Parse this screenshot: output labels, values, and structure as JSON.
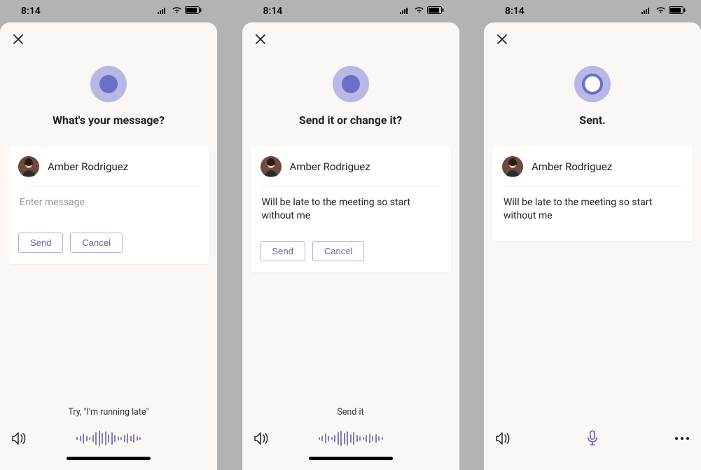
{
  "status": {
    "time": "8:14"
  },
  "screens": [
    {
      "prompt": "What's your message?",
      "recipient": "Amber Rodriguez",
      "placeholder": "Enter message",
      "message": "",
      "send_label": "Send",
      "cancel_label": "Cancel",
      "hint": "Try, \"I'm running late\"",
      "bottom_mode": "waveform",
      "orb": "solid",
      "show_more": false,
      "show_hint": true
    },
    {
      "prompt": "Send it or change it?",
      "recipient": "Amber Rodriguez",
      "message": "Will be late to the meeting so start without me",
      "send_label": "Send",
      "cancel_label": "Cancel",
      "hint": "Send it",
      "bottom_mode": "waveform",
      "orb": "solid",
      "show_more": false,
      "show_hint": true
    },
    {
      "prompt": "Sent.",
      "recipient": "Amber Rodriguez",
      "message": "Will be late to the meeting so start without me",
      "bottom_mode": "mic",
      "orb": "ring",
      "show_more": true,
      "show_hint": false
    }
  ]
}
